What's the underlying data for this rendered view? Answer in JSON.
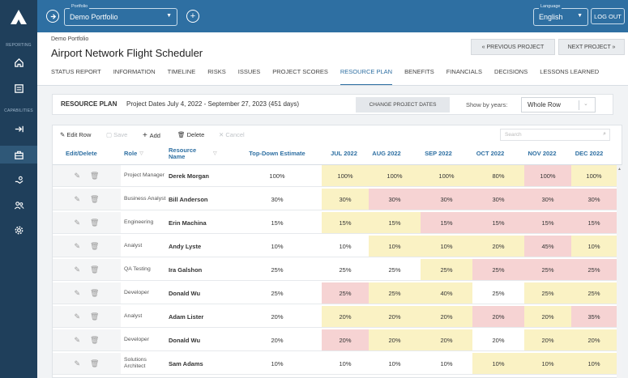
{
  "rail": {
    "reporting_label": "REPORTING",
    "capabilities_label": "CAPABILITIES"
  },
  "topbar": {
    "portfolio_legend": "Portfolio",
    "portfolio_value": "Demo Portfolio",
    "language_legend": "Language",
    "language_value": "English",
    "logout_label": "LOG OUT"
  },
  "header": {
    "breadcrumb": "Demo Portfolio",
    "title": "Airport Network Flight Scheduler",
    "prev_label": "« PREVIOUS PROJECT",
    "next_label": "NEXT PROJECT »"
  },
  "tabs": [
    {
      "label": "STATUS REPORT"
    },
    {
      "label": "INFORMATION"
    },
    {
      "label": "TIMELINE"
    },
    {
      "label": "RISKS"
    },
    {
      "label": "ISSUES"
    },
    {
      "label": "PROJECT SCORES"
    },
    {
      "label": "RESOURCE PLAN"
    },
    {
      "label": "BENEFITS"
    },
    {
      "label": "FINANCIALS"
    },
    {
      "label": "DECISIONS"
    },
    {
      "label": "LESSONS LEARNED"
    }
  ],
  "plan": {
    "label": "RESOURCE PLAN",
    "dates": "Project Dates  July 4, 2022 - September 27, 2023 (451 days)",
    "change_label": "CHANGE PROJECT DATES",
    "show_by_label": "Show by years:",
    "show_by_value": "Whole Row"
  },
  "toolbar": {
    "edit_row": "Edit Row",
    "save": "Save",
    "add": "Add",
    "delete": "Delete",
    "cancel": "Cancel",
    "search_placeholder": "Search"
  },
  "columns": {
    "edit_delete": "Edit/Delete",
    "role": "Role",
    "resource_name": "Resource Name",
    "estimate": "Top-Down Estimate",
    "months": [
      {
        "label": "JUL 2022"
      },
      {
        "label": "AUG 2022"
      },
      {
        "label": "SEP 2022"
      },
      {
        "label": "OCT 2022"
      },
      {
        "label": "NOV 2022"
      },
      {
        "label": "DEC 2022"
      }
    ]
  },
  "rows": [
    {
      "role": "Project Manager",
      "name": "Derek Morgan",
      "estimate": "100%",
      "m": [
        "100%",
        "100%",
        "100%",
        "80%",
        "100%",
        "100%"
      ],
      "c": [
        "y",
        "y",
        "y",
        "y",
        "p",
        "y"
      ]
    },
    {
      "role": "Business Analyst",
      "name": "Bill Anderson",
      "estimate": "30%",
      "m": [
        "30%",
        "30%",
        "30%",
        "30%",
        "30%",
        "30%"
      ],
      "c": [
        "y",
        "p",
        "p",
        "p",
        "p",
        "p"
      ]
    },
    {
      "role": "Engineering",
      "name": "Erin Machina",
      "estimate": "15%",
      "m": [
        "15%",
        "15%",
        "15%",
        "15%",
        "15%",
        "15%"
      ],
      "c": [
        "y",
        "y",
        "p",
        "p",
        "p",
        "p"
      ]
    },
    {
      "role": "Analyst",
      "name": "Andy Lyste",
      "estimate": "10%",
      "m": [
        "10%",
        "10%",
        "10%",
        "20%",
        "45%",
        "10%"
      ],
      "c": [
        "w",
        "y",
        "y",
        "y",
        "p",
        "y"
      ]
    },
    {
      "role": "QA Testing",
      "name": "Ira Galshon",
      "estimate": "25%",
      "m": [
        "25%",
        "25%",
        "25%",
        "25%",
        "25%",
        "25%"
      ],
      "c": [
        "w",
        "w",
        "y",
        "p",
        "p",
        "p"
      ]
    },
    {
      "role": "Developer",
      "name": "Donald Wu",
      "estimate": "25%",
      "m": [
        "25%",
        "25%",
        "40%",
        "25%",
        "25%",
        "25%"
      ],
      "c": [
        "p",
        "y",
        "y",
        "w",
        "y",
        "y"
      ]
    },
    {
      "role": "Analyst",
      "name": "Adam Lister",
      "estimate": "20%",
      "m": [
        "20%",
        "20%",
        "20%",
        "20%",
        "20%",
        "35%"
      ],
      "c": [
        "y",
        "y",
        "y",
        "p",
        "y",
        "p"
      ]
    },
    {
      "role": "Developer",
      "name": "Donald Wu",
      "estimate": "20%",
      "m": [
        "20%",
        "20%",
        "20%",
        "20%",
        "20%",
        "20%"
      ],
      "c": [
        "p",
        "y",
        "y",
        "w",
        "y",
        "y"
      ]
    },
    {
      "role": "Solutions Architect",
      "name": "Sam Adams",
      "estimate": "10%",
      "m": [
        "10%",
        "10%",
        "10%",
        "10%",
        "10%",
        "10%"
      ],
      "c": [
        "w",
        "w",
        "w",
        "y",
        "y",
        "y"
      ]
    }
  ],
  "colors": {
    "topbar": "#2e6fa2",
    "rail": "#1f3f5b",
    "yellow": "#faf2c4",
    "pink": "#f6d3d3"
  }
}
